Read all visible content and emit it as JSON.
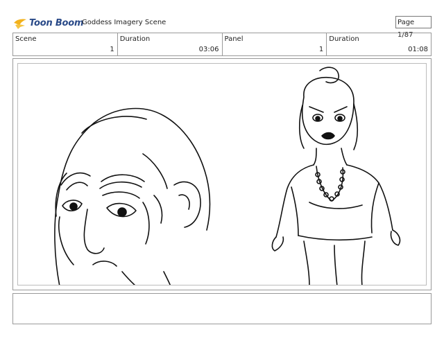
{
  "header": {
    "logo_text": "Toon Boom",
    "title": "Goddess Imagery Scene",
    "page_label": "Page",
    "page_value": "1/87"
  },
  "info": {
    "scene_label": "Scene",
    "scene_value": "1",
    "scene_duration_label": "Duration",
    "scene_duration_value": "03:06",
    "panel_label": "Panel",
    "panel_value": "1",
    "panel_duration_label": "Duration",
    "panel_duration_value": "01:08"
  },
  "notes": {
    "text": ""
  }
}
